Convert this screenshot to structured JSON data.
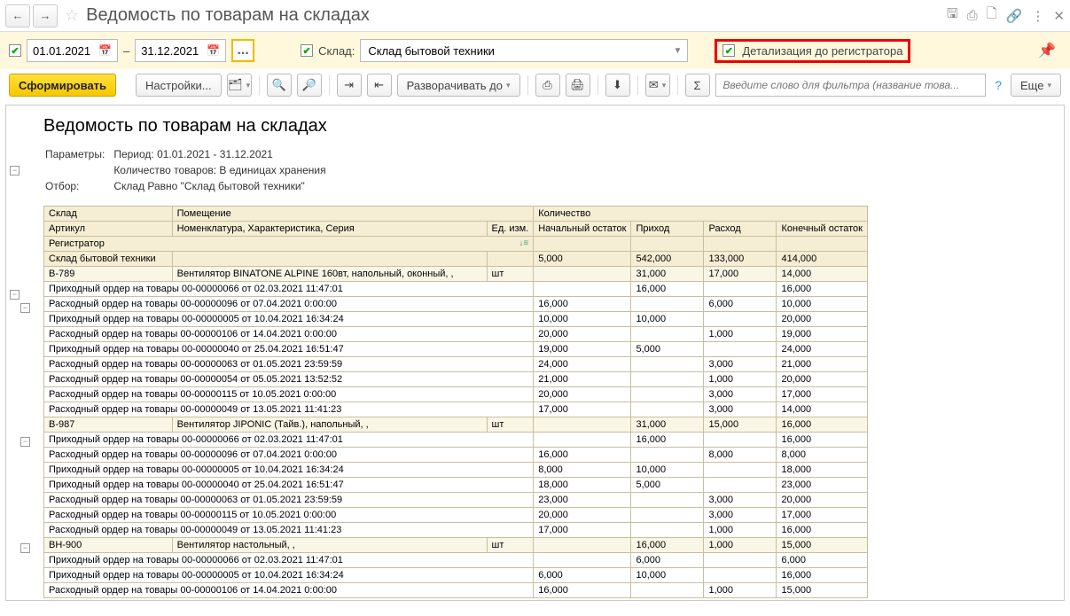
{
  "title": "Ведомость по товарам на складах",
  "date_from": "01.01.2021",
  "date_to": "31.12.2021",
  "date_sep": "–",
  "warehouse_label": "Склад:",
  "warehouse_value": "Склад бытовой техники",
  "detail_label": "Детализация до регистратора",
  "toolbar": {
    "generate": "Сформировать",
    "settings": "Настройки...",
    "expand": "Разворачивать до",
    "more": "Еще",
    "filter_placeholder": "Введите слово для фильтра (название това..."
  },
  "report": {
    "title": "Ведомость по товарам на складах",
    "params_label": "Параметры:",
    "period": "Период: 01.01.2021 - 31.12.2021",
    "qty": "Количество товаров: В единицах хранения",
    "filter_label": "Отбор:",
    "filter_value": "Склад Равно \"Склад бытовой техники\""
  },
  "headers": {
    "warehouse": "Склад",
    "room": "Помещение",
    "qty": "Количество",
    "article": "Артикул",
    "nomen": "Номенклатура, Характеристика, Серия",
    "unit": "Ед. изм.",
    "start": "Начальный остаток",
    "in": "Приход",
    "out": "Расход",
    "end": "Конечный остаток",
    "reg": "Регистратор"
  },
  "rows": [
    {
      "lvl": 1,
      "c1": "Склад бытовой техники",
      "c2": "",
      "u": "",
      "s": "5,000",
      "i": "542,000",
      "o": "133,000",
      "e": "414,000"
    },
    {
      "lvl": 2,
      "c1": "В-789",
      "c2": "Вентилятор BINATONE ALPINE 160вт, напольный, оконный, ,",
      "u": "шт",
      "s": "",
      "i": "31,000",
      "o": "17,000",
      "e": "14,000"
    },
    {
      "lvl": 3,
      "c1": "",
      "c2": "Приходный ордер на товары 00-00000066 от 02.03.2021 11:47:01",
      "u": "",
      "s": "",
      "i": "16,000",
      "o": "",
      "e": "16,000"
    },
    {
      "lvl": 3,
      "c1": "",
      "c2": "Расходный ордер на товары 00-00000096 от 07.04.2021 0:00:00",
      "u": "",
      "s": "16,000",
      "i": "",
      "o": "6,000",
      "e": "10,000"
    },
    {
      "lvl": 3,
      "c1": "",
      "c2": "Приходный ордер на товары 00-00000005 от 10.04.2021 16:34:24",
      "u": "",
      "s": "10,000",
      "i": "10,000",
      "o": "",
      "e": "20,000"
    },
    {
      "lvl": 3,
      "c1": "",
      "c2": "Расходный ордер на товары 00-00000106 от 14.04.2021 0:00:00",
      "u": "",
      "s": "20,000",
      "i": "",
      "o": "1,000",
      "e": "19,000"
    },
    {
      "lvl": 3,
      "c1": "",
      "c2": "Приходный ордер на товары 00-00000040 от 25.04.2021 16:51:47",
      "u": "",
      "s": "19,000",
      "i": "5,000",
      "o": "",
      "e": "24,000"
    },
    {
      "lvl": 3,
      "c1": "",
      "c2": "Расходный ордер на товары 00-00000063 от 01.05.2021 23:59:59",
      "u": "",
      "s": "24,000",
      "i": "",
      "o": "3,000",
      "e": "21,000"
    },
    {
      "lvl": 3,
      "c1": "",
      "c2": "Расходный ордер на товары 00-00000054 от 05.05.2021 13:52:52",
      "u": "",
      "s": "21,000",
      "i": "",
      "o": "1,000",
      "e": "20,000"
    },
    {
      "lvl": 3,
      "c1": "",
      "c2": "Расходный ордер на товары 00-00000115 от 10.05.2021 0:00:00",
      "u": "",
      "s": "20,000",
      "i": "",
      "o": "3,000",
      "e": "17,000"
    },
    {
      "lvl": 3,
      "c1": "",
      "c2": "Расходный ордер на товары 00-00000049 от 13.05.2021 11:41:23",
      "u": "",
      "s": "17,000",
      "i": "",
      "o": "3,000",
      "e": "14,000"
    },
    {
      "lvl": 2,
      "c1": "В-987",
      "c2": "Вентилятор JIPONIC (Тайв.), напольный, ,",
      "u": "шт",
      "s": "",
      "i": "31,000",
      "o": "15,000",
      "e": "16,000"
    },
    {
      "lvl": 3,
      "c1": "",
      "c2": "Приходный ордер на товары 00-00000066 от 02.03.2021 11:47:01",
      "u": "",
      "s": "",
      "i": "16,000",
      "o": "",
      "e": "16,000"
    },
    {
      "lvl": 3,
      "c1": "",
      "c2": "Расходный ордер на товары 00-00000096 от 07.04.2021 0:00:00",
      "u": "",
      "s": "16,000",
      "i": "",
      "o": "8,000",
      "e": "8,000"
    },
    {
      "lvl": 3,
      "c1": "",
      "c2": "Приходный ордер на товары 00-00000005 от 10.04.2021 16:34:24",
      "u": "",
      "s": "8,000",
      "i": "10,000",
      "o": "",
      "e": "18,000"
    },
    {
      "lvl": 3,
      "c1": "",
      "c2": "Приходный ордер на товары 00-00000040 от 25.04.2021 16:51:47",
      "u": "",
      "s": "18,000",
      "i": "5,000",
      "o": "",
      "e": "23,000"
    },
    {
      "lvl": 3,
      "c1": "",
      "c2": "Расходный ордер на товары 00-00000063 от 01.05.2021 23:59:59",
      "u": "",
      "s": "23,000",
      "i": "",
      "o": "3,000",
      "e": "20,000"
    },
    {
      "lvl": 3,
      "c1": "",
      "c2": "Расходный ордер на товары 00-00000115 от 10.05.2021 0:00:00",
      "u": "",
      "s": "20,000",
      "i": "",
      "o": "3,000",
      "e": "17,000"
    },
    {
      "lvl": 3,
      "c1": "",
      "c2": "Расходный ордер на товары 00-00000049 от 13.05.2021 11:41:23",
      "u": "",
      "s": "17,000",
      "i": "",
      "o": "1,000",
      "e": "16,000"
    },
    {
      "lvl": 2,
      "c1": "ВН-900",
      "c2": "Вентилятор настольный, ,",
      "u": "шт",
      "s": "",
      "i": "16,000",
      "o": "1,000",
      "e": "15,000"
    },
    {
      "lvl": 3,
      "c1": "",
      "c2": "Приходный ордер на товары 00-00000066 от 02.03.2021 11:47:01",
      "u": "",
      "s": "",
      "i": "6,000",
      "o": "",
      "e": "6,000"
    },
    {
      "lvl": 3,
      "c1": "",
      "c2": "Приходный ордер на товары 00-00000005 от 10.04.2021 16:34:24",
      "u": "",
      "s": "6,000",
      "i": "10,000",
      "o": "",
      "e": "16,000"
    },
    {
      "lvl": 3,
      "c1": "",
      "c2": "Расходный ордер на товары 00-00000106 от 14.04.2021 0:00:00",
      "u": "",
      "s": "16,000",
      "i": "",
      "o": "1,000",
      "e": "15,000"
    }
  ]
}
